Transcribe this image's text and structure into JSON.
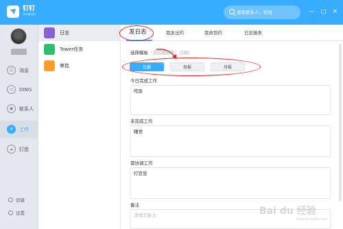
{
  "app": {
    "name": "钉钉",
    "subtitle": "Dingtalk",
    "search_placeholder": "搜索联系人，群组",
    "colors": {
      "primary": "#38adff",
      "annotation": "#d9262b"
    }
  },
  "window_controls": {
    "minimize": "—",
    "maximize": "□",
    "close": "✕"
  },
  "nav": {
    "items": [
      {
        "label": "消息",
        "icon": "message-icon"
      },
      {
        "label": "DING",
        "icon": "ding-icon"
      },
      {
        "label": "联系人",
        "icon": "contacts-icon"
      },
      {
        "label": "工作",
        "icon": "work-icon",
        "active": true
      },
      {
        "label": "钉盘",
        "icon": "cloud-drive-icon"
      }
    ],
    "bottom": [
      {
        "label": "创建",
        "icon": "create-icon"
      },
      {
        "label": "设置",
        "icon": "settings-icon"
      }
    ]
  },
  "apps": {
    "items": [
      {
        "label": "日志",
        "icon": "log-icon",
        "color": "#8a63d2",
        "active": true
      },
      {
        "label": "Tower任务",
        "icon": "tower-task-icon",
        "color": "#2fbf71"
      },
      {
        "label": "审批",
        "icon": "approval-icon",
        "color": "#ff9a2e"
      }
    ]
  },
  "main": {
    "tabs": [
      {
        "label": "发日志",
        "active": true
      },
      {
        "label": "我发出的"
      },
      {
        "label": "我收到的"
      },
      {
        "label": "日志报表"
      }
    ],
    "template": {
      "label": "选择模板",
      "hint": "（当前模板为：日报）",
      "options": [
        {
          "label": "日报",
          "active": true
        },
        {
          "label": "周报"
        },
        {
          "label": "月报"
        }
      ]
    },
    "fields": [
      {
        "label": "今日完成工作",
        "value": "吃饭"
      },
      {
        "label": "未完成工作",
        "value": "睡觉"
      },
      {
        "label": "需协调工作",
        "value": "打豆豆"
      },
      {
        "label": "备注",
        "placeholder": "请填写备注"
      }
    ]
  },
  "watermark": {
    "text": "Bai du 经验",
    "sub": "jingyan.baidu.com"
  }
}
